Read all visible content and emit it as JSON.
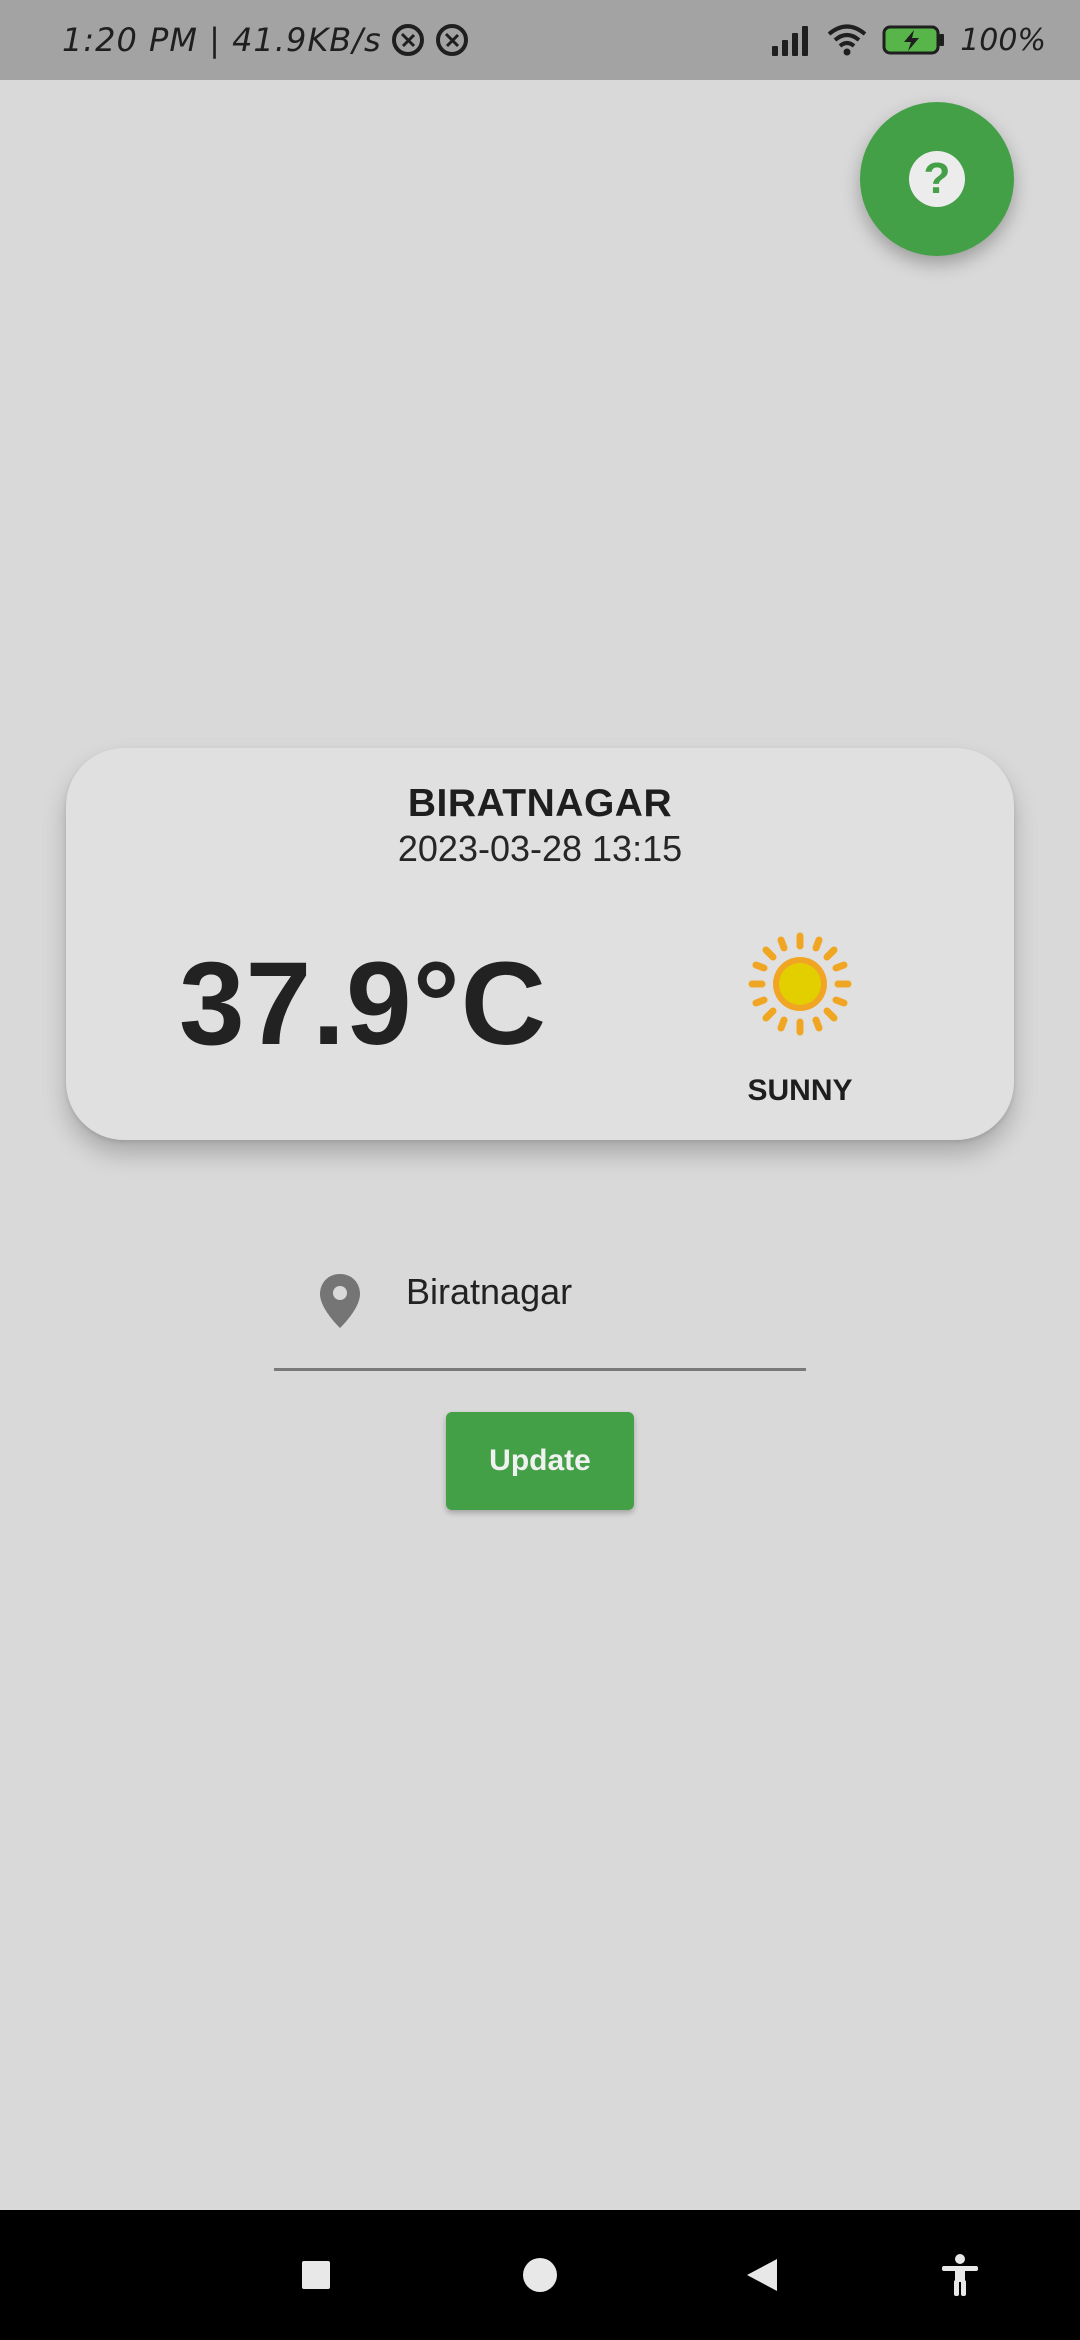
{
  "status_bar": {
    "time_speed": "1:20 PM | 41.9KB/s",
    "battery_percent": "100%",
    "icons": [
      "data-saver-icon",
      "data-saver-icon",
      "signal-icon",
      "wifi-icon",
      "battery-charging-icon"
    ]
  },
  "help_button": {
    "icon": "help-icon",
    "glyph": "?"
  },
  "weather_card": {
    "city": "BIRATNAGAR",
    "datetime": "2023-03-28 13:15",
    "temperature": "37.9°C",
    "condition": "SUNNY",
    "condition_icon": "sun-icon"
  },
  "location_input": {
    "icon": "location-pin-icon",
    "value": "Biratnagar"
  },
  "update_button": {
    "label": "Update"
  },
  "nav_bar": {
    "buttons": [
      "recents-button",
      "home-button",
      "back-button",
      "accessibility-button"
    ]
  },
  "colors": {
    "accent": "#43a047",
    "background": "#d9d9d9",
    "card": "#e0e0e0",
    "status_bar": "#a3a3a3",
    "sun": "#e8c800",
    "sun_rays": "#f0a623"
  }
}
